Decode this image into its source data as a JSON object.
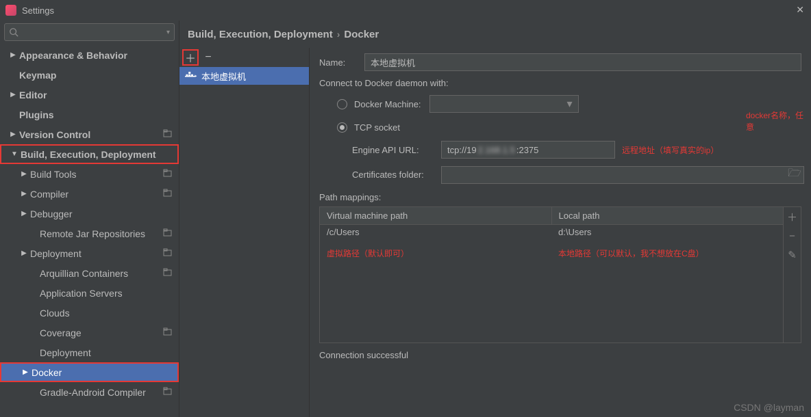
{
  "window": {
    "title": "Settings"
  },
  "search": {
    "placeholder": ""
  },
  "tree": [
    {
      "label": "Appearance & Behavior",
      "level": 1,
      "arrow": "▶",
      "bold": true
    },
    {
      "label": "Keymap",
      "level": 1,
      "arrow": "",
      "bold": true
    },
    {
      "label": "Editor",
      "level": 1,
      "arrow": "▶",
      "bold": true
    },
    {
      "label": "Plugins",
      "level": 1,
      "arrow": "",
      "bold": true
    },
    {
      "label": "Version Control",
      "level": 1,
      "arrow": "▶",
      "bold": true,
      "proj": true
    },
    {
      "label": "Build, Execution, Deployment",
      "level": 1,
      "arrow": "▼",
      "bold": true,
      "redbox": true
    },
    {
      "label": "Build Tools",
      "level": 2,
      "arrow": "▶",
      "proj": true
    },
    {
      "label": "Compiler",
      "level": 2,
      "arrow": "▶",
      "proj": true
    },
    {
      "label": "Debugger",
      "level": 2,
      "arrow": "▶"
    },
    {
      "label": "Remote Jar Repositories",
      "level": 2,
      "arrow": "",
      "proj": true,
      "indent3": true
    },
    {
      "label": "Deployment",
      "level": 2,
      "arrow": "▶",
      "proj": true
    },
    {
      "label": "Arquillian Containers",
      "level": 2,
      "arrow": "",
      "proj": true,
      "indent3": true
    },
    {
      "label": "Application Servers",
      "level": 2,
      "arrow": "",
      "indent3": true
    },
    {
      "label": "Clouds",
      "level": 2,
      "arrow": "",
      "indent3": true
    },
    {
      "label": "Coverage",
      "level": 2,
      "arrow": "",
      "proj": true,
      "indent3": true
    },
    {
      "label": "Deployment",
      "level": 2,
      "arrow": "",
      "indent3": true
    },
    {
      "label": "Docker",
      "level": 2,
      "arrow": "▶",
      "selected": true,
      "redbox": true
    },
    {
      "label": "Gradle-Android Compiler",
      "level": 2,
      "arrow": "",
      "proj": true,
      "indent3": true
    }
  ],
  "breadcrumb": {
    "part1": "Build, Execution, Deployment",
    "part2": "Docker"
  },
  "list": {
    "entry": "本地虚拟机"
  },
  "form": {
    "name_label": "Name:",
    "name_value": "本地虚拟机",
    "name_annotation": "docker名称，任意",
    "connect_label": "Connect to Docker daemon with:",
    "docker_machine_label": "Docker Machine:",
    "tcp_socket_label": "TCP socket",
    "engine_url_label": "Engine API URL:",
    "engine_url_value_pre": "tcp://19",
    "engine_url_value_post": ":2375",
    "engine_url_annotation": "远程地址（填写真实的ip）",
    "cert_folder_label": "Certificates folder:",
    "cert_folder_value": "",
    "mappings_label": "Path mappings:",
    "col_vm": "Virtual machine path",
    "col_local": "Local path",
    "vm_path": "/c/Users",
    "local_path": "d:\\Users",
    "vm_note": "虚拟路径（默认即可）",
    "local_note": "本地路径（可以默认，我不想放在C盘）",
    "status": "Connection successful"
  },
  "watermark": "CSDN @layman"
}
